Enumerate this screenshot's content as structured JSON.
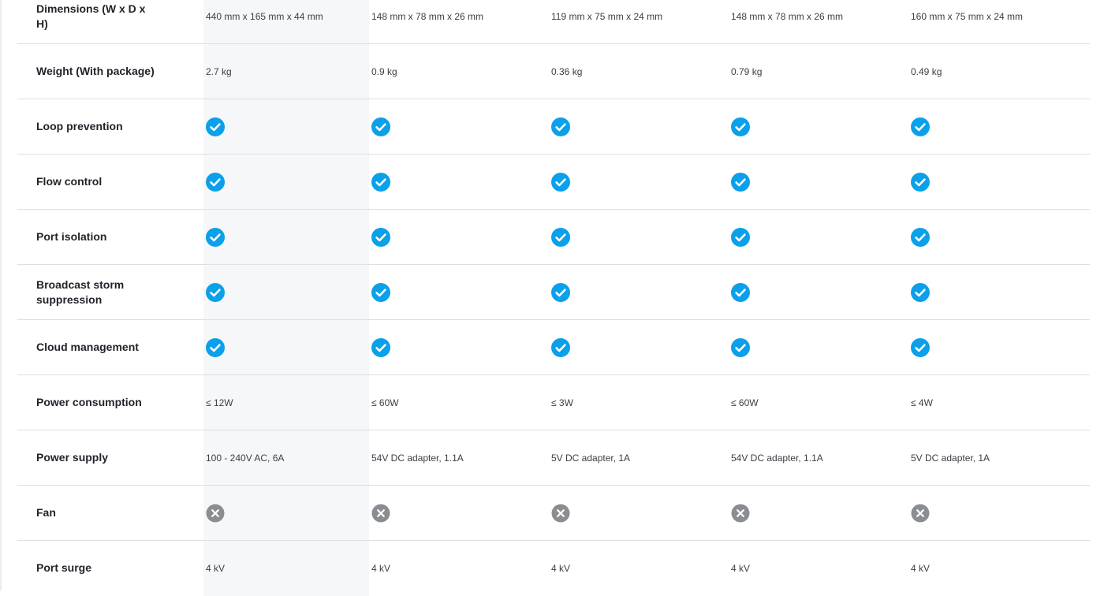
{
  "colors": {
    "check": "#0aa0ea",
    "cross": "#8a8d91",
    "highlight_column": "#f6f7f9",
    "divider": "#dcdfe3"
  },
  "rows": [
    {
      "label": "Dimensions (W x D x H)",
      "type": "text",
      "values": [
        "440 mm x 165 mm x 44 mm",
        "148 mm x 78 mm x 26 mm",
        "119 mm x 75 mm x 24 mm",
        "148 mm x 78 mm x 26 mm",
        "160 mm x 75 mm x 24 mm"
      ]
    },
    {
      "label": "Weight (With package)",
      "type": "text",
      "values": [
        "2.7 kg",
        "0.9 kg",
        "0.36 kg",
        "0.79 kg",
        "0.49 kg"
      ]
    },
    {
      "label": "Loop prevention",
      "type": "icon",
      "values": [
        "check-icon",
        "check-icon",
        "check-icon",
        "check-icon",
        "check-icon"
      ]
    },
    {
      "label": "Flow control",
      "type": "icon",
      "values": [
        "check-icon",
        "check-icon",
        "check-icon",
        "check-icon",
        "check-icon"
      ]
    },
    {
      "label": "Port isolation",
      "type": "icon",
      "values": [
        "check-icon",
        "check-icon",
        "check-icon",
        "check-icon",
        "check-icon"
      ]
    },
    {
      "label": "Broadcast storm suppression",
      "type": "icon",
      "values": [
        "check-icon",
        "check-icon",
        "check-icon",
        "check-icon",
        "check-icon"
      ]
    },
    {
      "label": "Cloud management",
      "type": "icon",
      "values": [
        "check-icon",
        "check-icon",
        "check-icon",
        "check-icon",
        "check-icon"
      ]
    },
    {
      "label": "Power consumption",
      "type": "text",
      "values": [
        "≤ 12W",
        "≤ 60W",
        "≤ 3W",
        "≤ 60W",
        "≤ 4W"
      ]
    },
    {
      "label": "Power supply",
      "type": "text",
      "values": [
        "100 - 240V AC, 6A",
        "54V DC adapter, 1.1A",
        "5V DC adapter, 1A",
        "54V DC adapter, 1.1A",
        "5V DC adapter, 1A"
      ]
    },
    {
      "label": "Fan",
      "type": "icon",
      "values": [
        "cross-icon",
        "cross-icon",
        "cross-icon",
        "cross-icon",
        "cross-icon"
      ]
    },
    {
      "label": "Port surge",
      "type": "text",
      "values": [
        "4 kV",
        "4 kV",
        "4 kV",
        "4 kV",
        "4 kV"
      ]
    }
  ]
}
